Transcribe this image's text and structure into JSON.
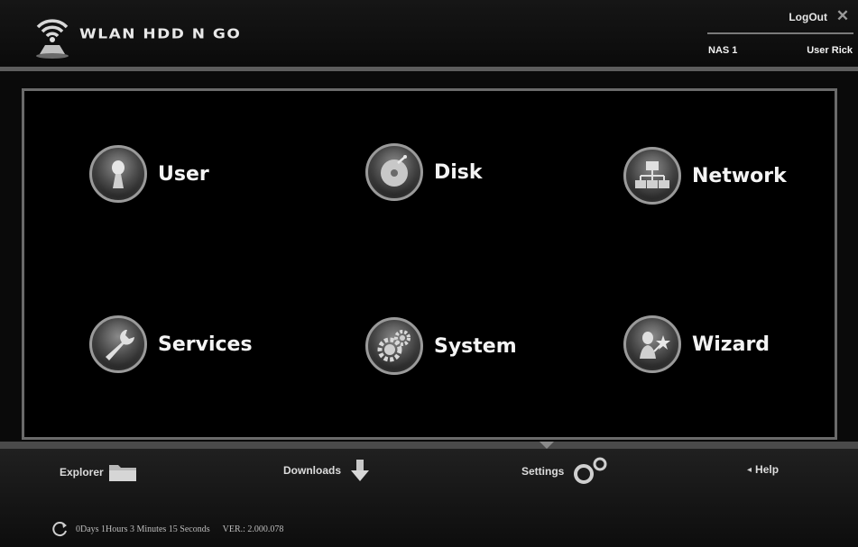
{
  "header": {
    "brand": "WLAN HDD N GO",
    "logout_label": "LogOut",
    "close_glyph": "✕",
    "nas_label": "NAS 1",
    "user_label": "User Rick",
    "logo_icon": "wifi-broadcast-icon"
  },
  "menu": [
    {
      "label": "User",
      "icon": "user-icon"
    },
    {
      "label": "Disk",
      "icon": "disk-icon"
    },
    {
      "label": "Network",
      "icon": "network-icon"
    },
    {
      "label": "Services",
      "icon": "wrench-icon"
    },
    {
      "label": "System",
      "icon": "gears-icon"
    },
    {
      "label": "Wizard",
      "icon": "wizard-icon"
    }
  ],
  "footer": {
    "explorer_label": "Explorer",
    "downloads_label": "Downloads",
    "settings_label": "Settings",
    "help_label": "Help",
    "uptime": "0Days 1Hours 3 Minutes 15 Seconds",
    "version": "VER.: 2.000.078"
  },
  "colors": {
    "background": "#000000",
    "frame": "#6a6a6a",
    "text": "#f4f4f4"
  }
}
